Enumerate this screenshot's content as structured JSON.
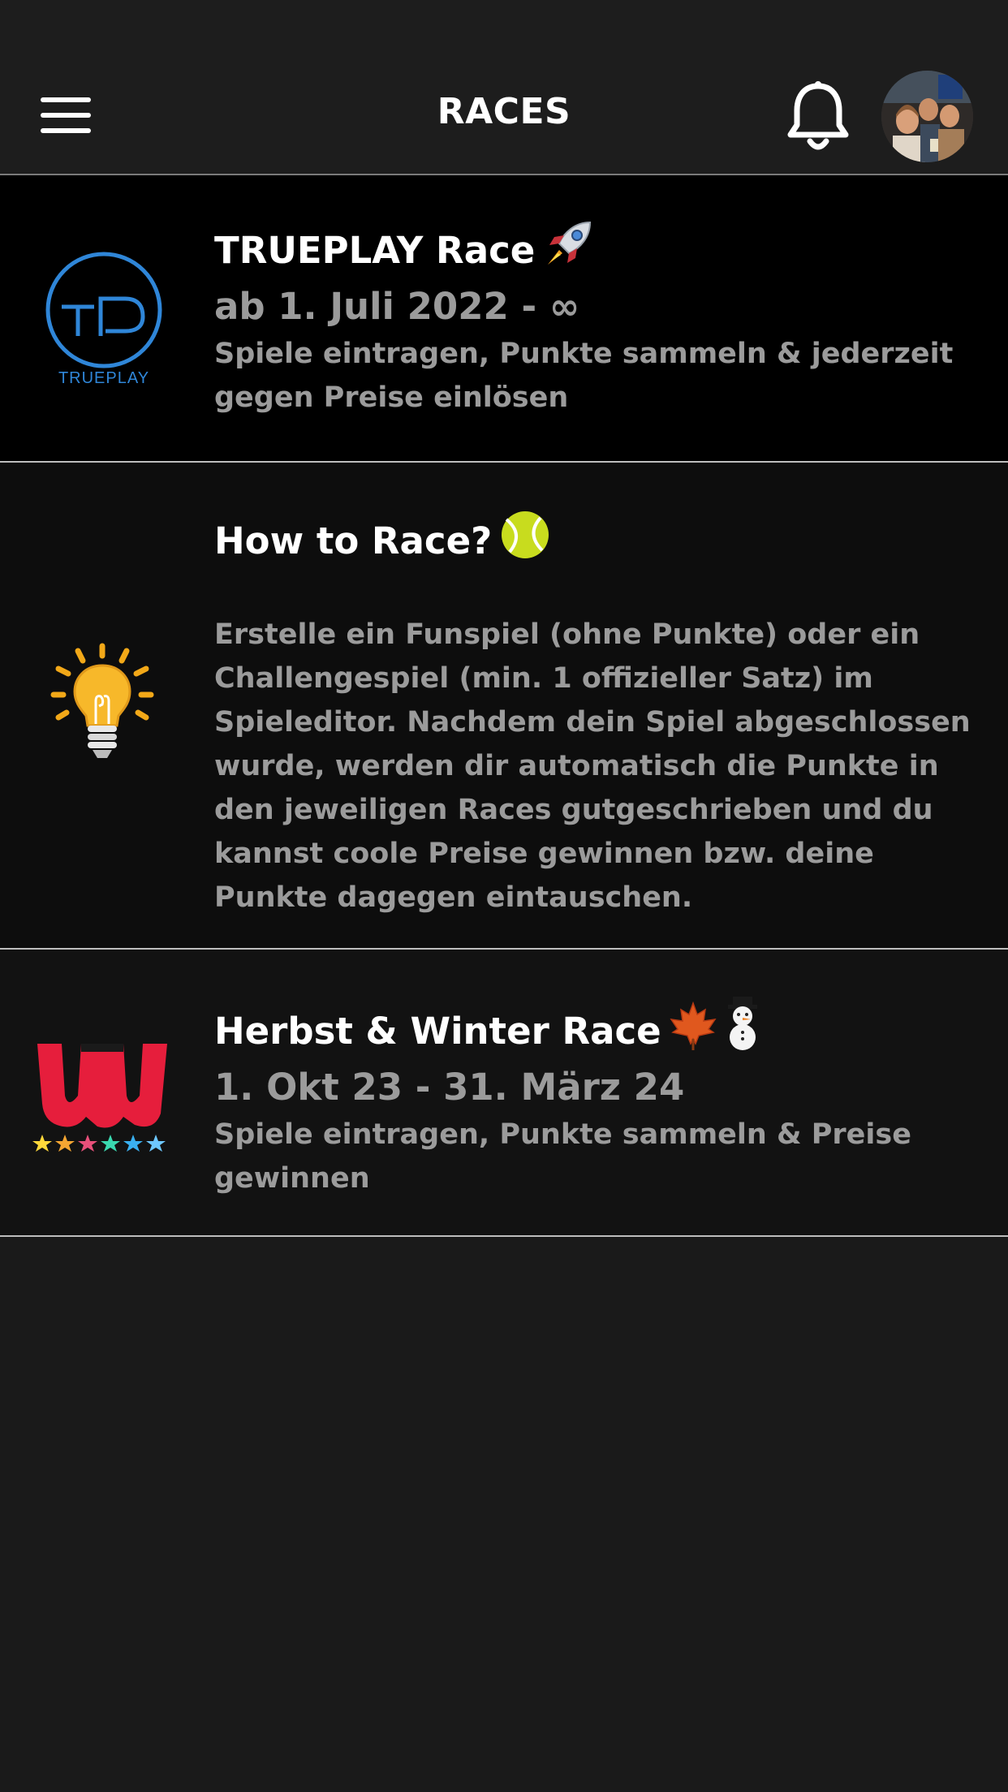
{
  "header": {
    "title": "RACES",
    "menu_icon": "hamburger-menu-icon",
    "bell_icon": "bell-icon",
    "avatar_icon": "user-avatar"
  },
  "races": [
    {
      "logo": "trueplay-logo",
      "logo_text": "TRUEPLAY",
      "title": "TRUEPLAY Race",
      "title_emoji": "rocket-icon",
      "subtitle": "ab 1. Juli 2022 - ∞",
      "description_lines": [
        "Spiele eintragen, Punkte sammeln & jederzeit",
        "gegen Preise einlösen"
      ]
    },
    {
      "logo": "lightbulb-icon",
      "title": "How to Race?",
      "title_emoji": "tennis-ball-icon",
      "description_lines": [
        "Erstelle ein Funspiel (ohne Punkte) oder ein",
        "Challengespiel (min. 1 offizieller Satz) im",
        "Spieleditor. Nachdem dein Spiel abgeschlossen",
        "wurde, werden dir automatisch die Punkte in",
        "den jeweiligen Races gutgeschrieben und du",
        "kannst coole Preise gewinnen bzw. deine",
        "Punkte dagegen eintauschen."
      ]
    },
    {
      "logo": "wilson-logo",
      "title": "Herbst & Winter Race",
      "title_emoji": "maple-leaf-snowman-icons",
      "subtitle": "1. Okt 23 - 31. März 24",
      "description_lines": [
        "Spiele eintragen, Punkte sammeln & Preise",
        "gewinnen"
      ]
    }
  ],
  "colors": {
    "background": "#1a1a1a",
    "header_bg": "#1d1d1d",
    "text_primary": "#ffffff",
    "text_secondary": "#9b9b9b",
    "trueplay_blue": "#2f86d8",
    "wilson_red": "#e61e3c"
  }
}
